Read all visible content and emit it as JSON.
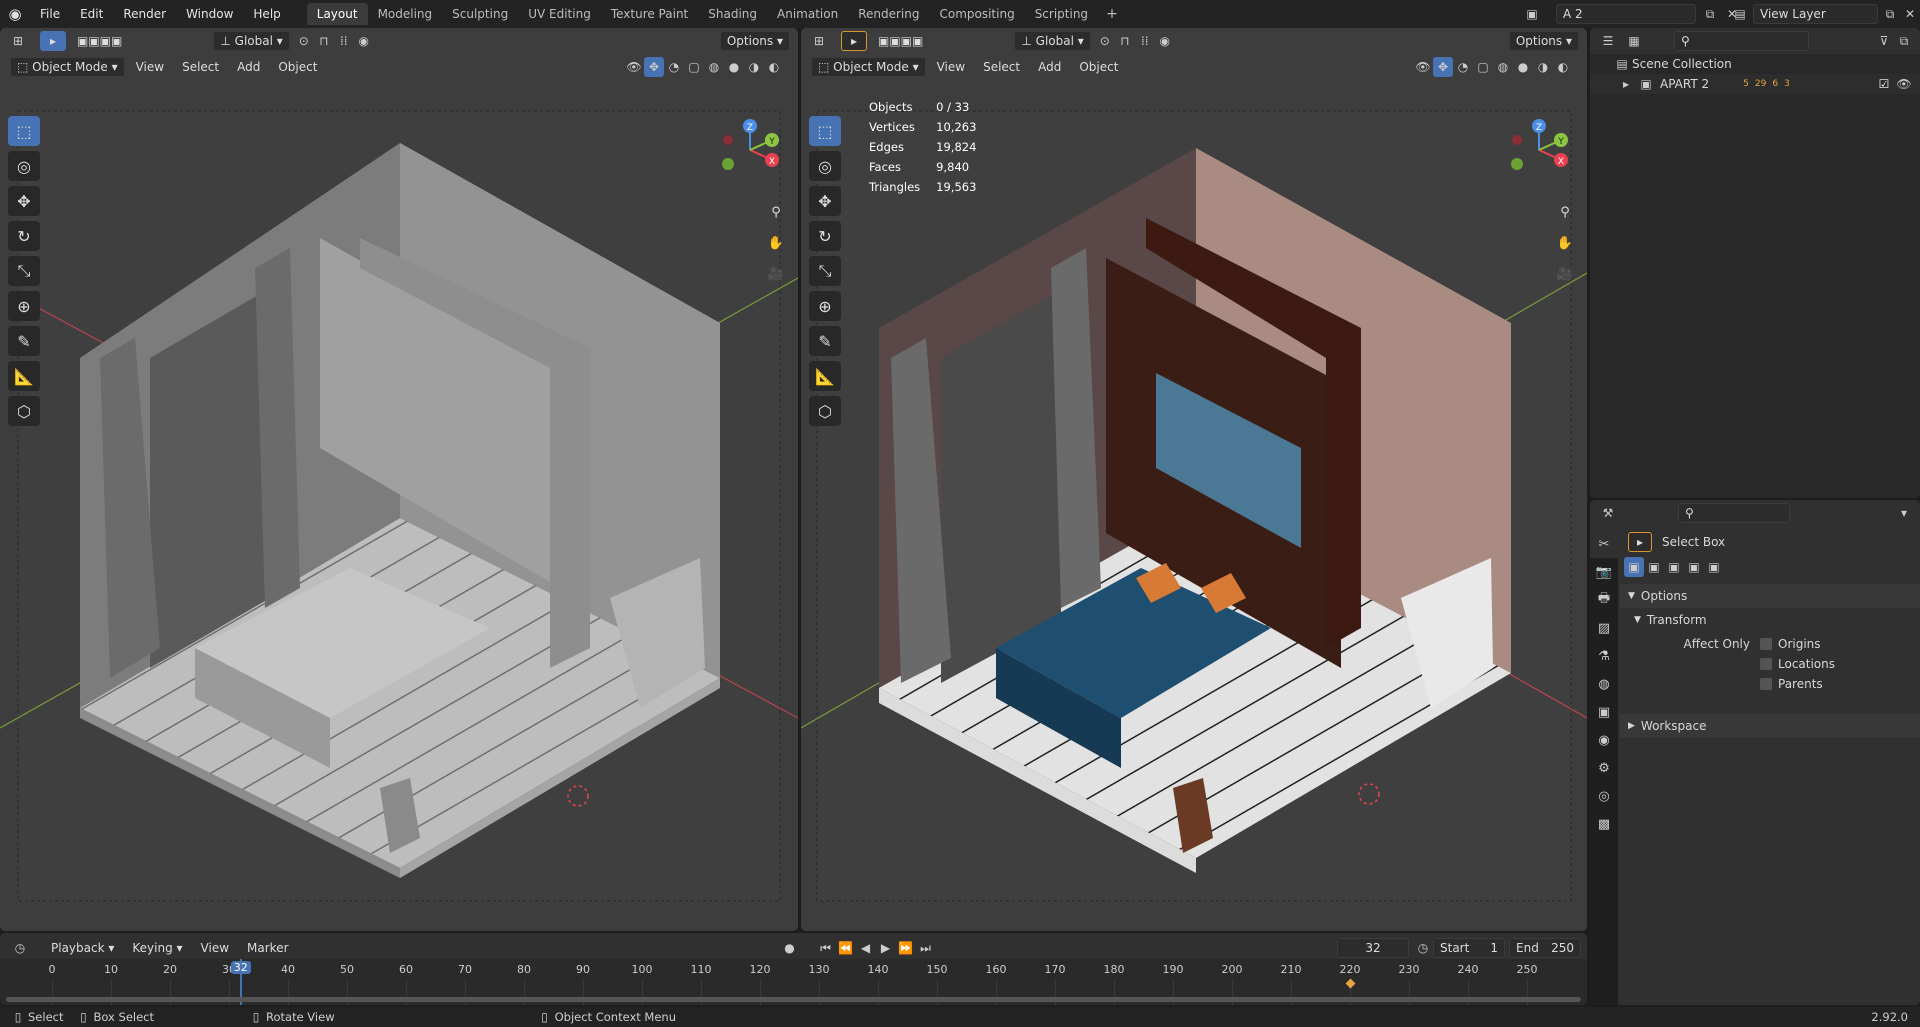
{
  "topbar": {
    "menus": [
      "File",
      "Edit",
      "Render",
      "Window",
      "Help"
    ],
    "workspaces": [
      "Layout",
      "Modeling",
      "Sculpting",
      "UV Editing",
      "Texture Paint",
      "Shading",
      "Animation",
      "Rendering",
      "Compositing",
      "Scripting"
    ],
    "active_workspace": "Layout",
    "add_tab": "+",
    "scene": "A 2",
    "view_layer": "View Layer"
  },
  "viewport_left": {
    "mode": "Object Mode",
    "menus": [
      "View",
      "Select",
      "Add",
      "Object"
    ],
    "orientation": "Global",
    "options": "Options",
    "axes": {
      "x": "X",
      "y": "Y",
      "z": "Z"
    }
  },
  "viewport_right": {
    "mode": "Object Mode",
    "menus": [
      "View",
      "Select",
      "Add",
      "Object"
    ],
    "orientation": "Global",
    "options": "Options",
    "axes": {
      "x": "X",
      "y": "Y",
      "z": "Z"
    },
    "stats": [
      {
        "label": "Objects",
        "value": "0 / 33"
      },
      {
        "label": "Vertices",
        "value": "10,263"
      },
      {
        "label": "Edges",
        "value": "19,824"
      },
      {
        "label": "Faces",
        "value": "9,840"
      },
      {
        "label": "Triangles",
        "value": "19,563"
      }
    ]
  },
  "outliner": {
    "root": "Scene Collection",
    "collection": "APART 2",
    "counts": [
      "5",
      "29",
      "6",
      "3"
    ]
  },
  "properties": {
    "tool_name": "Select Box",
    "options_label": "Options",
    "transform_label": "Transform",
    "affect_only_label": "Affect Only",
    "checkboxes": [
      "Origins",
      "Locations",
      "Parents"
    ],
    "workspace_label": "Workspace"
  },
  "timeline": {
    "menus": [
      "Playback",
      "Keying",
      "View",
      "Marker"
    ],
    "current_frame": "32",
    "start_label": "Start",
    "start_value": "1",
    "end_label": "End",
    "end_value": "250",
    "ticks": [
      "0",
      "10",
      "20",
      "30",
      "40",
      "50",
      "60",
      "70",
      "80",
      "90",
      "100",
      "110",
      "120",
      "130",
      "140",
      "150",
      "160",
      "170",
      "180",
      "190",
      "200",
      "210",
      "220",
      "230",
      "240",
      "250"
    ],
    "keyframe_at": 220
  },
  "statusbar": {
    "items": [
      "Select",
      "Box Select",
      "Rotate View",
      "Object Context Menu"
    ],
    "version": "2.92.0"
  },
  "colors": {
    "accent": "#4772b3",
    "axis_x": "#e8414f",
    "axis_y": "#8cc63f",
    "axis_z": "#4b8fe8"
  }
}
